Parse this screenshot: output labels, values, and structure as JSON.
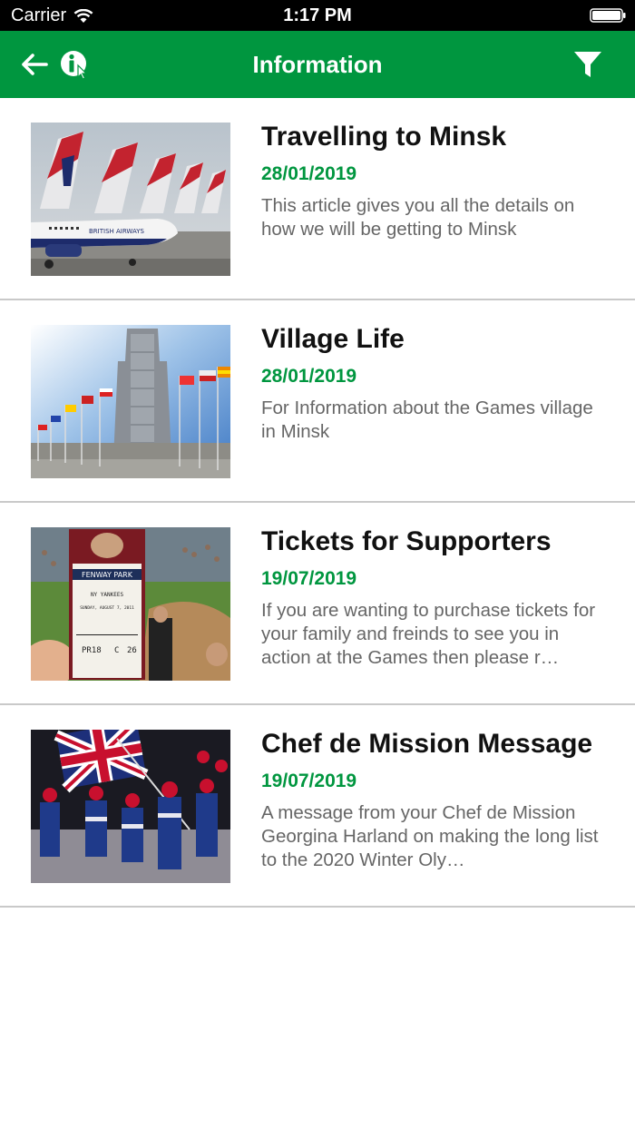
{
  "status_bar": {
    "carrier": "Carrier",
    "time": "1:17 PM",
    "icons": [
      "wifi-icon",
      "battery-icon"
    ]
  },
  "nav": {
    "title": "Information",
    "icons": [
      "back-arrow-icon",
      "info-icon",
      "filter-icon"
    ],
    "bar_color": "#00963f"
  },
  "articles": [
    {
      "title": "Travelling to Minsk",
      "date": "28/01/2019",
      "description": "This article gives you all the details on how we will be getting to Minsk",
      "image": "british-airways-planes"
    },
    {
      "title": "Village Life",
      "date": "28/01/2019",
      "description": "For Information about the Games village in Minsk",
      "image": "building-with-flags"
    },
    {
      "title": "Tickets for Supporters",
      "date": "19/07/2019",
      "description": "If you are wanting to purchase tickets for your family and freinds to see you in action at the Games then please r…",
      "image": "baseball-ticket"
    },
    {
      "title": "Chef de Mission Message",
      "date": "19/07/2019",
      "description": "A message from your Chef de Mission Georgina Harland on making the long list to the 2020 Winter Oly…",
      "image": "team-with-union-flag"
    }
  ],
  "colors": {
    "accent": "#00963f",
    "title_text": "#111111",
    "body_text": "#666666",
    "divider": "#c9c9c9"
  }
}
